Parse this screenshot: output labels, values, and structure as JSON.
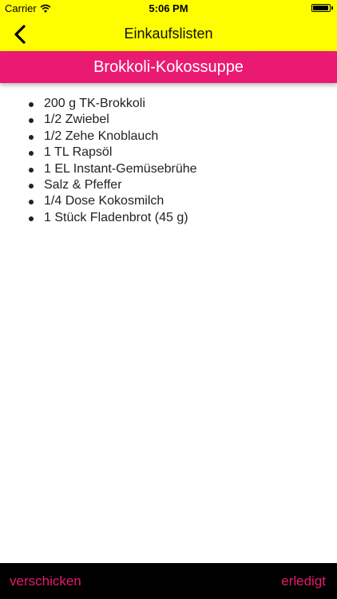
{
  "status_bar": {
    "carrier": "Carrier",
    "time": "5:06 PM",
    "wifi_icon": "wifi-icon",
    "battery_icon": "battery-icon"
  },
  "nav_bar": {
    "title": "Einkaufslisten",
    "back_icon": "chevron-left-icon"
  },
  "recipe": {
    "title": "Brokkoli-Kokossuppe",
    "ingredients": [
      "200 g TK-Brokkoli",
      "1/2 Zwiebel",
      "1/2 Zehe Knoblauch",
      "1 TL Rapsöl",
      "1 EL Instant-Gemüsebrühe",
      "Salz & Pfeffer",
      "1/4 Dose Kokosmilch",
      "1 Stück Fladenbrot (45 g)"
    ]
  },
  "bottom_bar": {
    "send_label": "verschicken",
    "done_label": "erledigt"
  },
  "colors": {
    "top_bar": "#fefe00",
    "header_band": "#ea1a72",
    "bottom_bar": "#000000",
    "action_text": "#e6196f"
  }
}
